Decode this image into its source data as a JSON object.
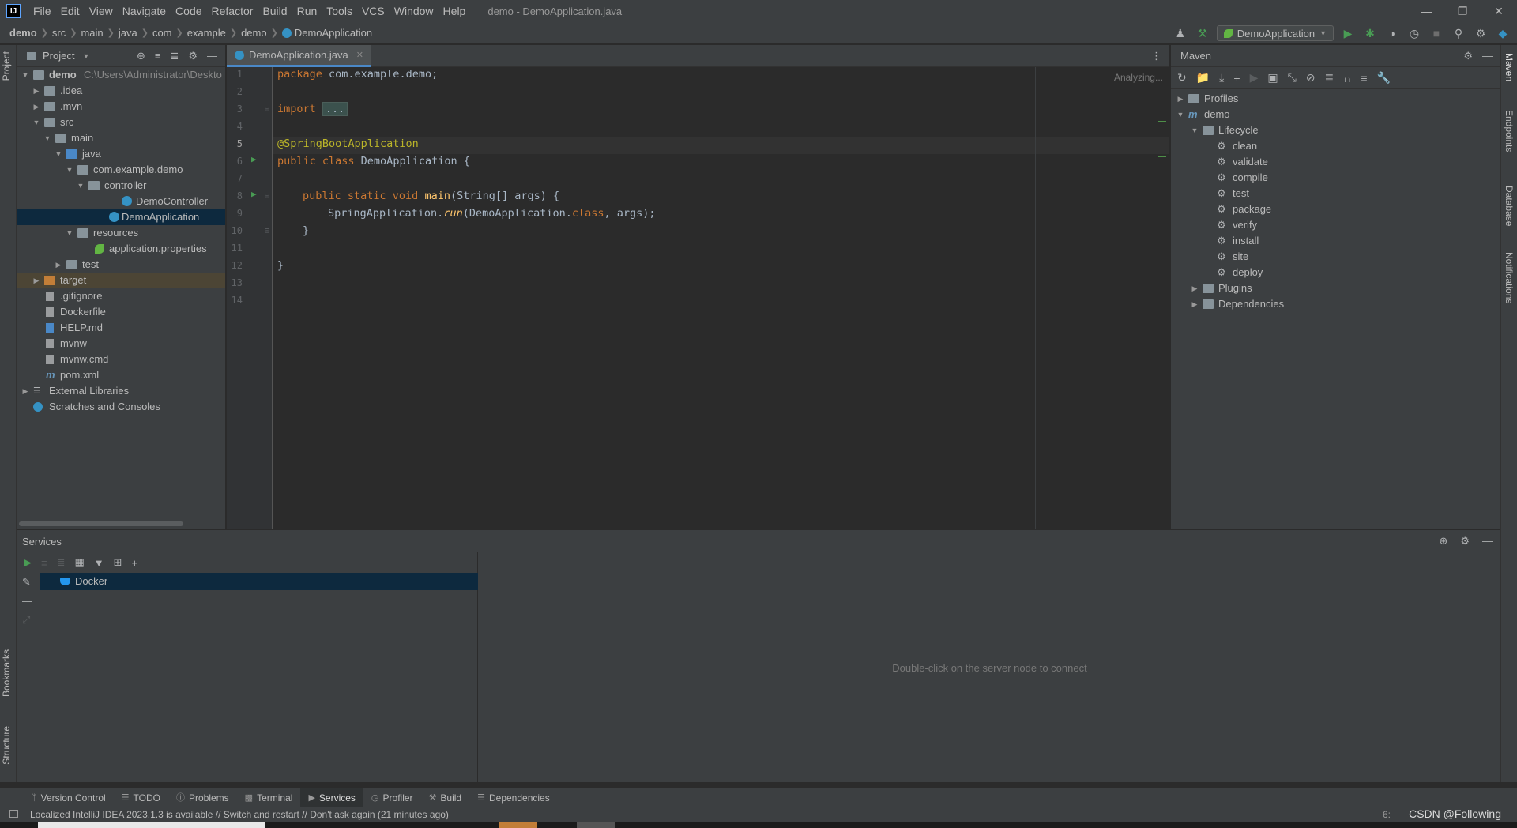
{
  "menubar": {
    "logo": "IJ",
    "items": [
      "File",
      "Edit",
      "View",
      "Navigate",
      "Code",
      "Refactor",
      "Build",
      "Run",
      "Tools",
      "VCS",
      "Window",
      "Help"
    ],
    "window_title": "demo - DemoApplication.java"
  },
  "breadcrumb": [
    "demo",
    "src",
    "main",
    "java",
    "com",
    "example",
    "demo",
    "DemoApplication"
  ],
  "run_config": "DemoApplication",
  "project_panel": {
    "title": "Project",
    "root_label": "demo",
    "root_path": "C:\\Users\\Administrator\\Deskto",
    "items": [
      {
        "label": "demo",
        "path": "C:\\Users\\Administrator\\Deskto"
      },
      {
        "label": ".idea"
      },
      {
        "label": ".mvn"
      },
      {
        "label": "src"
      },
      {
        "label": "main"
      },
      {
        "label": "java"
      },
      {
        "label": "com.example.demo"
      },
      {
        "label": "controller"
      },
      {
        "label": "DemoController"
      },
      {
        "label": "DemoApplication"
      },
      {
        "label": "resources"
      },
      {
        "label": "application.properties"
      },
      {
        "label": "test"
      },
      {
        "label": "target"
      },
      {
        "label": ".gitignore"
      },
      {
        "label": "Dockerfile"
      },
      {
        "label": "HELP.md"
      },
      {
        "label": "mvnw"
      },
      {
        "label": "mvnw.cmd"
      },
      {
        "label": "pom.xml"
      },
      {
        "label": "External Libraries"
      },
      {
        "label": "Scratches and Consoles"
      }
    ]
  },
  "editor": {
    "tab_label": "DemoApplication.java",
    "status": "Analyzing...",
    "line_numbers": [
      "1",
      "2",
      "3",
      "4",
      "5",
      "6",
      "7",
      "8",
      "9",
      "10",
      "11",
      "12",
      "13",
      "14"
    ],
    "code": {
      "l1_kw": "package",
      "l1_rest": " com.example.demo;",
      "l3_kw": "import",
      "l3_fold": "...",
      "l6_ann": "@SpringBootApplication",
      "l7_kw": "public class",
      "l7_rest": " DemoApplication {",
      "l9_kw": "public static void",
      "l9_fn": "main",
      "l9_rest": "(String[] args) {",
      "l10_a": "SpringApplication.",
      "l10_run": "run",
      "l10_b": "(DemoApplication.",
      "l10_cls": "class",
      "l10_c": ", args);",
      "l11": "}",
      "l13": "}"
    }
  },
  "maven_panel": {
    "title": "Maven",
    "tree": {
      "profiles": "Profiles",
      "project": "demo",
      "lifecycle": "Lifecycle",
      "goals": [
        "clean",
        "validate",
        "compile",
        "test",
        "package",
        "verify",
        "install",
        "site",
        "deploy"
      ],
      "plugins": "Plugins",
      "dependencies": "Dependencies"
    }
  },
  "right_stripe": [
    "Maven",
    "Endpoints",
    "Database",
    "Notifications"
  ],
  "left_stripe": [
    "Project",
    "Bookmarks",
    "Structure"
  ],
  "services": {
    "title": "Services",
    "docker_label": "Docker",
    "hint": "Double-click on the server node to connect"
  },
  "bottom_tabs": [
    "Version Control",
    "TODO",
    "Problems",
    "Terminal",
    "Services",
    "Profiler",
    "Build",
    "Dependencies"
  ],
  "status": {
    "message": "Localized IntelliJ IDEA 2023.1.3 is available // Switch and restart // Don't ask again (21 minutes ago)",
    "watermark": "CSDN @Following",
    "time_prefix": "6:"
  },
  "colors": {
    "background": "#2b2b2b",
    "panel": "#3c3f41",
    "selection": "#0d293e",
    "keyword": "#cc7832",
    "annotation": "#bbb529",
    "function": "#ffc66d",
    "accent": "#4a88c7"
  }
}
